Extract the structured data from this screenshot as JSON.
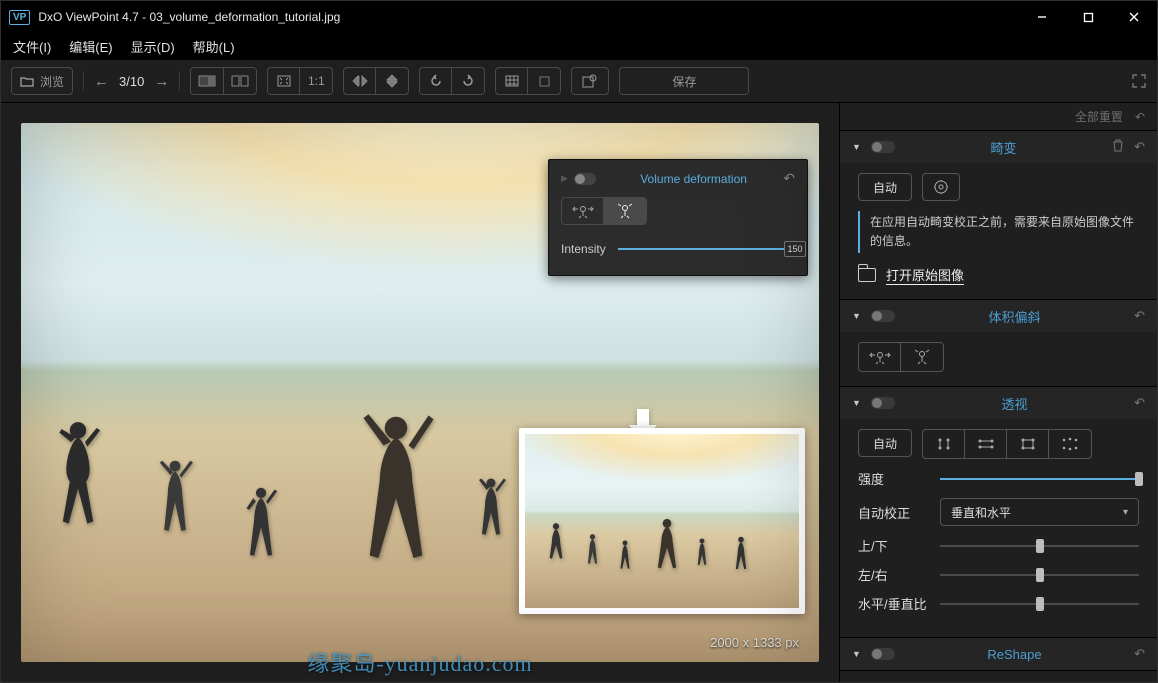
{
  "window": {
    "logo": "VP",
    "title": "DxO ViewPoint 4.7 - 03_volume_deformation_tutorial.jpg"
  },
  "menu": {
    "file": "文件(I)",
    "edit": "编辑(E)",
    "view": "显示(D)",
    "help": "帮助(L)"
  },
  "toolbar": {
    "browse": "浏览",
    "counter": "3/10",
    "oneToOne": "1:1",
    "save": "保存"
  },
  "viewer": {
    "dimensions": "2000 x 1333 px",
    "watermark": "缘聚岛-yuanjudao.com"
  },
  "overlay": {
    "title": "Volume deformation",
    "intensity_label": "Intensity",
    "intensity_value": "150",
    "intensity_pct": 100
  },
  "panel": {
    "reset_all": "全部重置",
    "s1": {
      "title": "畸变",
      "auto": "自动",
      "info": "在应用自动畸变校正之前，需要来自原始图像文件的信息。",
      "open_original": "打开原始图像"
    },
    "s2": {
      "title": "体积偏斜"
    },
    "s3": {
      "title": "透视",
      "auto": "自动",
      "intensity_label": "强度",
      "intensity_pct": 100,
      "autocorrect_label": "自动校正",
      "autocorrect_value": "垂直和水平",
      "updown_label": "上/下",
      "updown_pct": 50,
      "leftright_label": "左/右",
      "leftright_pct": 50,
      "hvratio_label": "水平/垂直比",
      "hvratio_pct": 50
    },
    "s4": {
      "title": "ReShape"
    }
  }
}
